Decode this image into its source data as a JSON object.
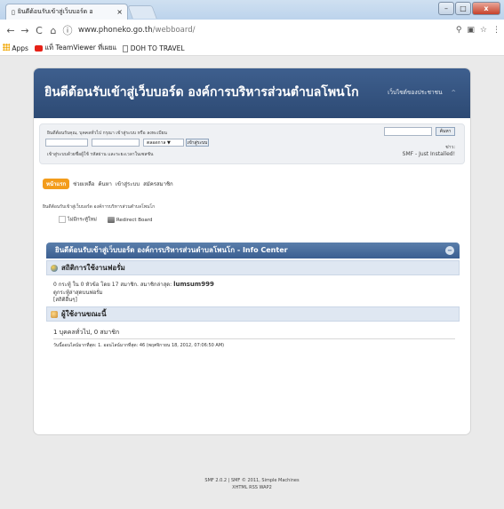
{
  "browser": {
    "tab_title": "ยินดีต้อนรับเข้าสู่เว็บบอร์ด อ",
    "tab_close": "×",
    "url_host": "www.phoneko.go.th",
    "url_path": "/webboard/",
    "bookmarks": [
      "Apps",
      "แท็ TeamViewer ที่เผยแ",
      "DOH TO TRAVEL"
    ]
  },
  "forum": {
    "title": "ยินดีต้อนรับเข้าสู่เว็บบอร์ด องค์การบริหารส่วนตำบลโพนโก",
    "news_toggle": "เว็บไซต์ของประชาชน",
    "login_text": "ยินดีต้อนรับคุณ, บุคคลทั่วไป กรุณา เข้าสู่ระบบ หรือ ลงทะเบียน",
    "forever_label": "ตลอดกาล ▼",
    "login_button": "เข้าสู่ระบบ",
    "quick_login_text": "เข้าสู่ระบบด้วยชื่อผู้ใช้ รหัสผ่าน และระยะเวลาในเซสชัน",
    "search_button": "ค้นหา",
    "news_label": "ข่าว:",
    "news_text": "SMF - Just Installed!",
    "menu": [
      "หน้าแรก",
      "ช่วยเหลือ",
      "ค้นหา",
      "เข้าสู่ระบบ",
      "สมัครสมาชิก"
    ],
    "welcome_text": "ยินดีต้อนรับเข้าสู่เว็บบอร์ด องค์การบริหารส่วนตำบลโพนโก",
    "opt_unread": "ไม่มีกระทู้ใหม่",
    "opt_redirect": "Redirect Board",
    "info_center_title": "ยินดีต้อนรับเข้าสู่เว็บบอร์ด องค์การบริหารส่วนตำบลโพนโก - Info Center",
    "stats_title": "สถิติการใช้งานฟอรั่ม",
    "stats_line1_prefix": "0 กระทู้ ใน 0 หัวข้อ โดย 17 สมาชิก. สมาชิกล่าสุด:",
    "stats_latest_member": "lumsum999",
    "stats_line2": "ดูกระทู้ล่าสุดบนฟอรั่ม",
    "stats_line3": "[สถิติอื่นๆ]",
    "online_title": "ผู้ใช้งานขณะนี้",
    "online_line": "1 บุคคลทั่วไป, 0 สมาชิก",
    "online_record": "วันนี้ออนไลน์มากที่สุด: 1. ออนไลน์มากที่สุด: 46 (พฤศจิกายน 18, 2012, 07:06:50 AM)"
  },
  "footer": {
    "line1": "SMF 2.0.2 | SMF © 2011, Simple Machines",
    "line2": "XHTML  RSS  WAP2"
  },
  "colors": {
    "header_blue": "#2d4a74",
    "menu_active": "#f39c1b"
  }
}
